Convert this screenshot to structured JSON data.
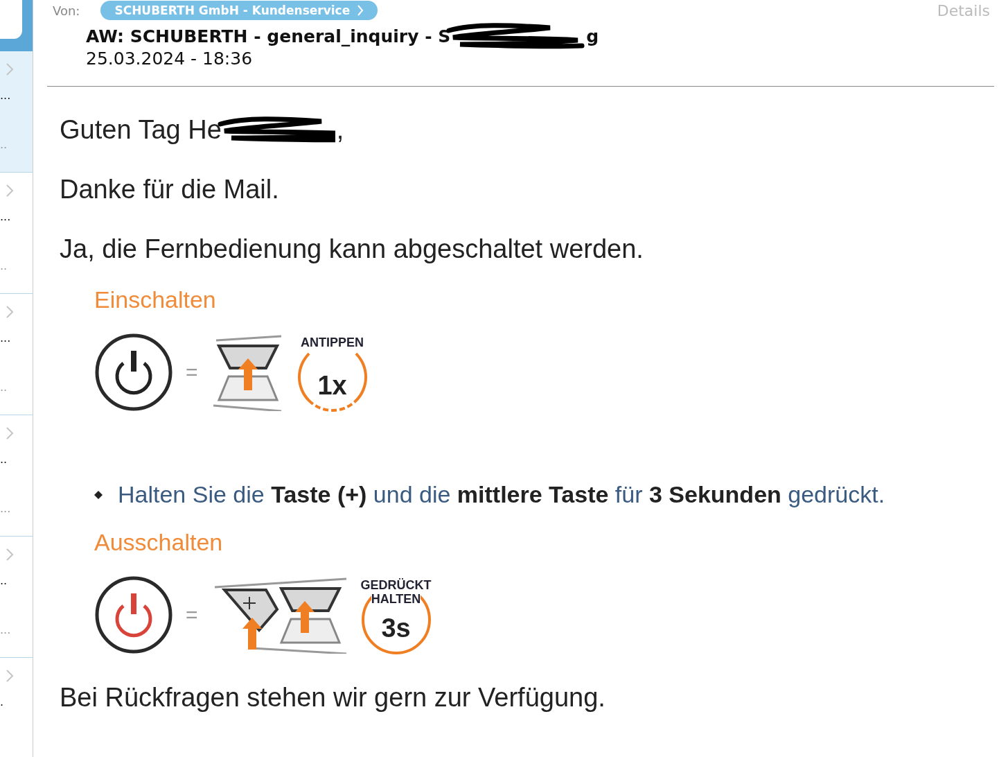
{
  "sidebar": {
    "items": [
      {
        "selected": true,
        "line1": "...",
        "line2": ".."
      },
      {
        "selected": false,
        "line1": "...",
        "line2": ".."
      },
      {
        "selected": false,
        "line1": "...",
        "line2": ".."
      },
      {
        "selected": false,
        "line1": "..",
        "line2": "..."
      },
      {
        "selected": false,
        "line1": "..",
        "line2": "..."
      },
      {
        "selected": false,
        "line1": "."
      }
    ]
  },
  "header": {
    "from_label": "Von:",
    "sender": "SCHUBERTH GmbH - Kundenservice",
    "details": "Details",
    "subject": "AW: SCHUBERTH - general_inquiry - S",
    "subject_tail": "g",
    "date": "25.03.2024 - 18:36"
  },
  "body": {
    "greeting": "Guten Tag He",
    "greeting_tail": ",",
    "paragraphs": [
      "Danke für die Mail.",
      "Ja, die Fernbedienung kann abgeschaltet werden."
    ],
    "figure": {
      "sections": [
        {
          "kind": "tap",
          "heading": "Einschalten",
          "equals": "=",
          "badge_top": "ANTIPPEN",
          "badge_value": "1x"
        },
        {
          "kind": "note",
          "text": "Halten Sie die **Taste (+)** und die **mittlere Taste** für **3 Sekunden** gedrückt."
        },
        {
          "kind": "hold",
          "heading": "Ausschalten",
          "equals": "=",
          "badge_top": "GEDRÜCKT",
          "badge_mid": "HALTEN",
          "badge_value": "3s"
        }
      ]
    },
    "closing": "Bei Rückfragen stehen wir gern zur Verfügung."
  }
}
